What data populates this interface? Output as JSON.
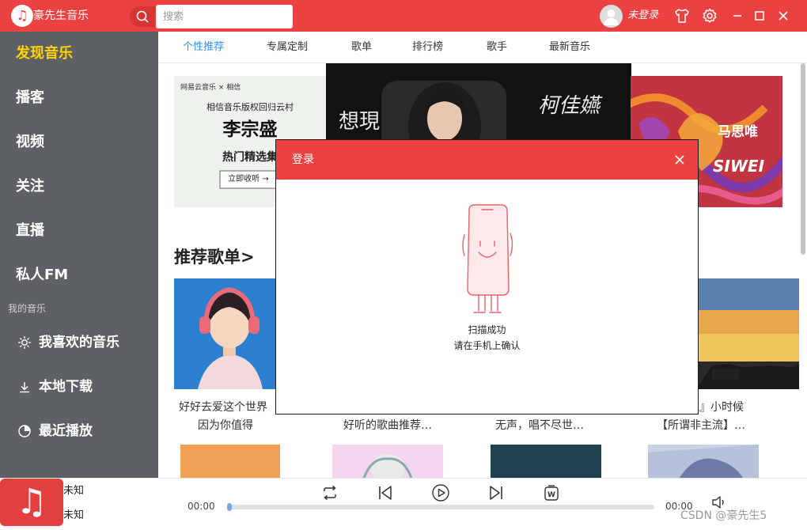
{
  "app": {
    "title": "豪先生音乐",
    "logo_glyph": "♫"
  },
  "search": {
    "placeholder": "搜索",
    "value": ""
  },
  "user": {
    "status": "未登录"
  },
  "titlebar": {
    "icons": [
      "skin-icon",
      "settings-icon",
      "minimize-icon",
      "maximize-icon",
      "close-icon"
    ]
  },
  "sidebar": {
    "items": [
      {
        "label": "发现音乐",
        "active": true
      },
      {
        "label": "播客"
      },
      {
        "label": "视频"
      },
      {
        "label": "关注"
      },
      {
        "label": "直播"
      },
      {
        "label": "私人FM"
      }
    ],
    "section_label": "我的音乐",
    "my_items": [
      {
        "label": "我喜欢的音乐",
        "icon": "sun-icon"
      },
      {
        "label": "本地下载",
        "icon": "download-icon"
      },
      {
        "label": "最近播放",
        "icon": "clock-icon"
      }
    ]
  },
  "tabs": [
    {
      "label": "个性推荐",
      "active": true
    },
    {
      "label": "专属定制"
    },
    {
      "label": "歌单"
    },
    {
      "label": "排行榜"
    },
    {
      "label": "歌手"
    },
    {
      "label": "最新音乐"
    }
  ],
  "banners": {
    "left": {
      "brand": "网易云音乐 × 相信",
      "line1": "相信音乐版权回归云村",
      "line2": "李宗盛",
      "line3": "热门精选集",
      "button": "立即收听 →"
    },
    "center": {
      "text_left": "想現",
      "text_right": "柯佳嬿"
    },
    "right": {
      "text": "马思唯",
      "text2": "SIWEI"
    }
  },
  "recommend": {
    "title": "推荐歌单>",
    "playlists": [
      {
        "line1": "好好去爱这个世界",
        "line2": "因为你值得"
      },
      {
        "line1": "",
        "line2": "好听的歌曲推荐…"
      },
      {
        "line1": "",
        "line2": "无声，唱不尽世…"
      },
      {
        "line1": "』小时候",
        "line2": "【所谓非主流】…"
      }
    ]
  },
  "player": {
    "track_title": "未知",
    "track_artist": "未知",
    "current_time": "00:00",
    "total_time": "00:00",
    "progress": 0,
    "controls": [
      "repeat-icon",
      "previous-icon",
      "play-icon",
      "next-icon",
      "lyrics-icon",
      "volume-icon"
    ],
    "watermark": "CSDN @豪先生5"
  },
  "modal": {
    "title": "登录",
    "status_line1": "扫描成功",
    "status_line2": "请在手机上确认"
  },
  "colors": {
    "brand": "#ec4141",
    "sidebar": "#5e6163",
    "active_nav": "#ffd400",
    "active_tab": "#2b8ff0"
  }
}
